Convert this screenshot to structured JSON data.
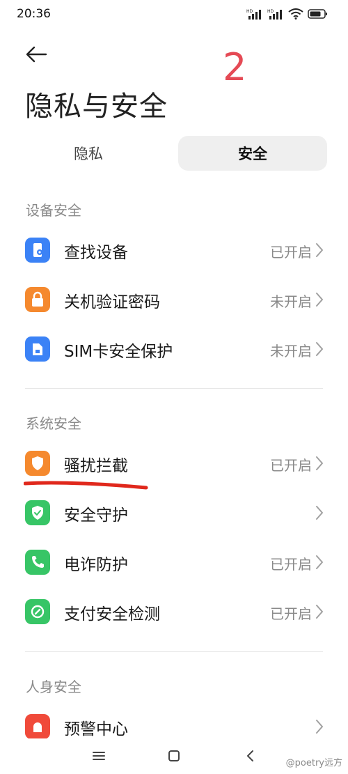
{
  "status_bar": {
    "time": "20:36",
    "network_label_1": "HD",
    "network_label_2": "HD"
  },
  "annotation": {
    "number": "2"
  },
  "page": {
    "title": "隐私与安全"
  },
  "tabs": [
    {
      "label": "隐私",
      "selected": false
    },
    {
      "label": "安全",
      "selected": true
    }
  ],
  "sections": [
    {
      "header": "设备安全",
      "items": [
        {
          "label": "查找设备",
          "status": "已开启",
          "icon": "find-device-icon",
          "color": "#3b82f6"
        },
        {
          "label": "关机验证密码",
          "status": "未开启",
          "icon": "lock-icon",
          "color": "#f5892e"
        },
        {
          "label": "SIM卡安全保护",
          "status": "未开启",
          "icon": "sim-card-icon",
          "color": "#3b82f6"
        }
      ]
    },
    {
      "header": "系统安全",
      "items": [
        {
          "label": "骚扰拦截",
          "status": "已开启",
          "icon": "shield-icon",
          "color": "#f5892e"
        },
        {
          "label": "安全守护",
          "status": "",
          "icon": "shield-check-icon",
          "color": "#37c566"
        },
        {
          "label": "电诈防护",
          "status": "已开启",
          "icon": "phone-icon",
          "color": "#37c566"
        },
        {
          "label": "支付安全检测",
          "status": "已开启",
          "icon": "payment-check-icon",
          "color": "#37c566"
        }
      ]
    },
    {
      "header": "人身安全",
      "items": [
        {
          "label": "预警中心",
          "status": "",
          "icon": "alert-icon",
          "color": "#f04a3a"
        }
      ]
    }
  ],
  "watermark": "@poetry远方"
}
